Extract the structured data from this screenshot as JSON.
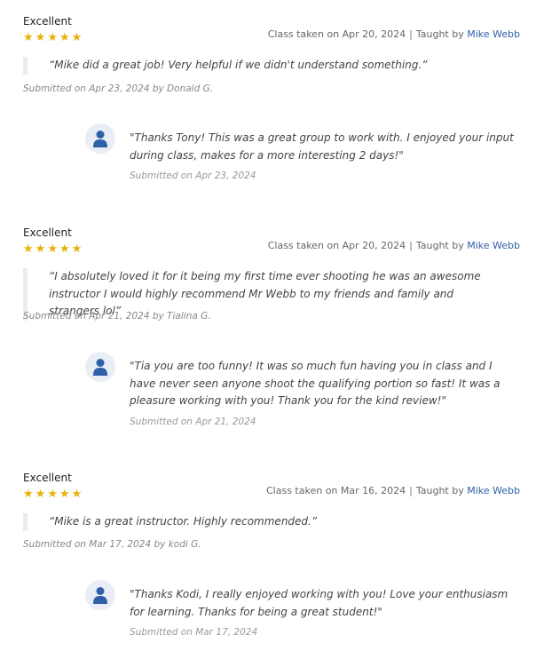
{
  "reviews": [
    {
      "rating_label": "Excellent",
      "stars": 5,
      "class_taken_prefix": "Class taken on",
      "class_date": "Apr 20, 2024",
      "taught_by_prefix": "Taught by",
      "instructor": "Mike Webb",
      "quote": "“Mike did a great job! Very helpful if we didn't understand something.”",
      "submitted": "Submitted on Apr 23, 2024 by Donald G.",
      "reply": {
        "text": "\"Thanks Tony! This was a great group to work with. I enjoyed your input during class, makes for a more interesting 2 days!\"",
        "submitted": "Submitted on Apr 23, 2024"
      }
    },
    {
      "rating_label": "Excellent",
      "stars": 5,
      "class_taken_prefix": "Class taken on",
      "class_date": "Apr 20, 2024",
      "taught_by_prefix": "Taught by",
      "instructor": "Mike Webb",
      "quote": "“I absolutely loved it for it being my first time ever shooting he was an awesome instructor I would highly recommend Mr Webb to my friends and family and strangers lol”",
      "submitted": "Submitted on Apr 21, 2024 by Tialina G.",
      "reply": {
        "text": "\"Tia you are too funny! It was so much fun having you in class and I have never seen anyone shoot the qualifying portion so fast! It was a pleasure working with you! Thank you for the kind review!\"",
        "submitted": "Submitted on Apr 21, 2024"
      }
    },
    {
      "rating_label": "Excellent",
      "stars": 5,
      "class_taken_prefix": "Class taken on",
      "class_date": "Mar 16, 2024",
      "taught_by_prefix": "Taught by",
      "instructor": "Mike Webb",
      "quote": "“Mike is a great instructor. Highly recommended.”",
      "submitted": "Submitted on Mar 17, 2024 by kodi G.",
      "reply": {
        "text": "\"Thanks Kodi, I really enjoyed working with you! Love your enthusiasm for learning. Thanks for being a great student!\"",
        "submitted": "Submitted on Mar 17, 2024"
      }
    }
  ],
  "colors": {
    "star": "#e8b008",
    "link": "#2f5fa8",
    "avatar_bg": "#e9edf5",
    "avatar_icon": "#2f5fa8"
  },
  "icons": {
    "star": "star-icon",
    "avatar": "user-icon"
  }
}
